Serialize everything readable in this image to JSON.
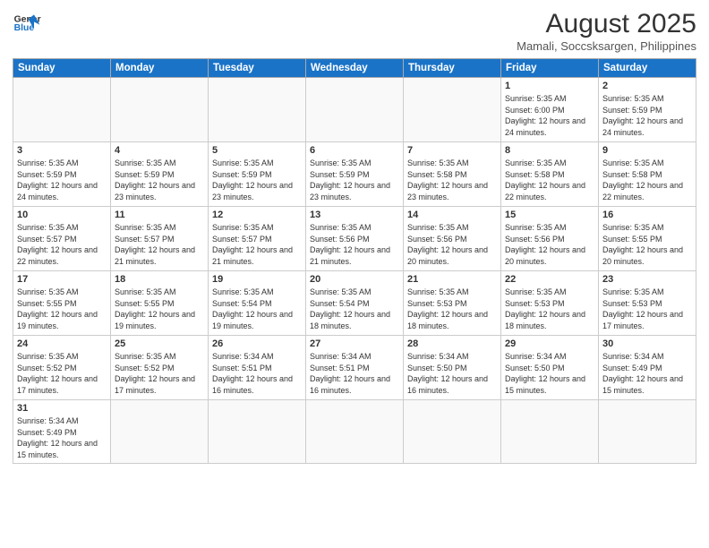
{
  "header": {
    "logo_line1": "General",
    "logo_line2": "Blue",
    "month_title": "August 2025",
    "location": "Mamali, Soccsksargen, Philippines"
  },
  "days_of_week": [
    "Sunday",
    "Monday",
    "Tuesday",
    "Wednesday",
    "Thursday",
    "Friday",
    "Saturday"
  ],
  "weeks": [
    [
      {
        "day": "",
        "info": ""
      },
      {
        "day": "",
        "info": ""
      },
      {
        "day": "",
        "info": ""
      },
      {
        "day": "",
        "info": ""
      },
      {
        "day": "",
        "info": ""
      },
      {
        "day": "1",
        "info": "Sunrise: 5:35 AM\nSunset: 6:00 PM\nDaylight: 12 hours and 24 minutes."
      },
      {
        "day": "2",
        "info": "Sunrise: 5:35 AM\nSunset: 5:59 PM\nDaylight: 12 hours and 24 minutes."
      }
    ],
    [
      {
        "day": "3",
        "info": "Sunrise: 5:35 AM\nSunset: 5:59 PM\nDaylight: 12 hours and 24 minutes."
      },
      {
        "day": "4",
        "info": "Sunrise: 5:35 AM\nSunset: 5:59 PM\nDaylight: 12 hours and 23 minutes."
      },
      {
        "day": "5",
        "info": "Sunrise: 5:35 AM\nSunset: 5:59 PM\nDaylight: 12 hours and 23 minutes."
      },
      {
        "day": "6",
        "info": "Sunrise: 5:35 AM\nSunset: 5:59 PM\nDaylight: 12 hours and 23 minutes."
      },
      {
        "day": "7",
        "info": "Sunrise: 5:35 AM\nSunset: 5:58 PM\nDaylight: 12 hours and 23 minutes."
      },
      {
        "day": "8",
        "info": "Sunrise: 5:35 AM\nSunset: 5:58 PM\nDaylight: 12 hours and 22 minutes."
      },
      {
        "day": "9",
        "info": "Sunrise: 5:35 AM\nSunset: 5:58 PM\nDaylight: 12 hours and 22 minutes."
      }
    ],
    [
      {
        "day": "10",
        "info": "Sunrise: 5:35 AM\nSunset: 5:57 PM\nDaylight: 12 hours and 22 minutes."
      },
      {
        "day": "11",
        "info": "Sunrise: 5:35 AM\nSunset: 5:57 PM\nDaylight: 12 hours and 21 minutes."
      },
      {
        "day": "12",
        "info": "Sunrise: 5:35 AM\nSunset: 5:57 PM\nDaylight: 12 hours and 21 minutes."
      },
      {
        "day": "13",
        "info": "Sunrise: 5:35 AM\nSunset: 5:56 PM\nDaylight: 12 hours and 21 minutes."
      },
      {
        "day": "14",
        "info": "Sunrise: 5:35 AM\nSunset: 5:56 PM\nDaylight: 12 hours and 20 minutes."
      },
      {
        "day": "15",
        "info": "Sunrise: 5:35 AM\nSunset: 5:56 PM\nDaylight: 12 hours and 20 minutes."
      },
      {
        "day": "16",
        "info": "Sunrise: 5:35 AM\nSunset: 5:55 PM\nDaylight: 12 hours and 20 minutes."
      }
    ],
    [
      {
        "day": "17",
        "info": "Sunrise: 5:35 AM\nSunset: 5:55 PM\nDaylight: 12 hours and 19 minutes."
      },
      {
        "day": "18",
        "info": "Sunrise: 5:35 AM\nSunset: 5:55 PM\nDaylight: 12 hours and 19 minutes."
      },
      {
        "day": "19",
        "info": "Sunrise: 5:35 AM\nSunset: 5:54 PM\nDaylight: 12 hours and 19 minutes."
      },
      {
        "day": "20",
        "info": "Sunrise: 5:35 AM\nSunset: 5:54 PM\nDaylight: 12 hours and 18 minutes."
      },
      {
        "day": "21",
        "info": "Sunrise: 5:35 AM\nSunset: 5:53 PM\nDaylight: 12 hours and 18 minutes."
      },
      {
        "day": "22",
        "info": "Sunrise: 5:35 AM\nSunset: 5:53 PM\nDaylight: 12 hours and 18 minutes."
      },
      {
        "day": "23",
        "info": "Sunrise: 5:35 AM\nSunset: 5:53 PM\nDaylight: 12 hours and 17 minutes."
      }
    ],
    [
      {
        "day": "24",
        "info": "Sunrise: 5:35 AM\nSunset: 5:52 PM\nDaylight: 12 hours and 17 minutes."
      },
      {
        "day": "25",
        "info": "Sunrise: 5:35 AM\nSunset: 5:52 PM\nDaylight: 12 hours and 17 minutes."
      },
      {
        "day": "26",
        "info": "Sunrise: 5:34 AM\nSunset: 5:51 PM\nDaylight: 12 hours and 16 minutes."
      },
      {
        "day": "27",
        "info": "Sunrise: 5:34 AM\nSunset: 5:51 PM\nDaylight: 12 hours and 16 minutes."
      },
      {
        "day": "28",
        "info": "Sunrise: 5:34 AM\nSunset: 5:50 PM\nDaylight: 12 hours and 16 minutes."
      },
      {
        "day": "29",
        "info": "Sunrise: 5:34 AM\nSunset: 5:50 PM\nDaylight: 12 hours and 15 minutes."
      },
      {
        "day": "30",
        "info": "Sunrise: 5:34 AM\nSunset: 5:49 PM\nDaylight: 12 hours and 15 minutes."
      }
    ],
    [
      {
        "day": "31",
        "info": "Sunrise: 5:34 AM\nSunset: 5:49 PM\nDaylight: 12 hours and 15 minutes."
      },
      {
        "day": "",
        "info": ""
      },
      {
        "day": "",
        "info": ""
      },
      {
        "day": "",
        "info": ""
      },
      {
        "day": "",
        "info": ""
      },
      {
        "day": "",
        "info": ""
      },
      {
        "day": "",
        "info": ""
      }
    ]
  ]
}
